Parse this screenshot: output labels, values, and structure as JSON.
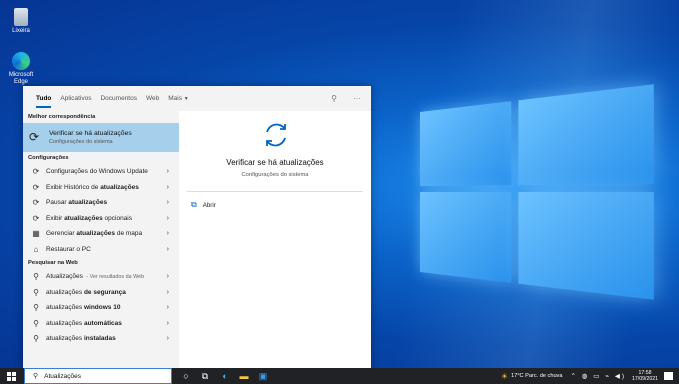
{
  "desktop": {
    "icons": [
      {
        "label": "Lixeira",
        "icon": "recycle-bin-icon"
      },
      {
        "label": "Microsoft Edge",
        "icon": "edge-icon"
      }
    ]
  },
  "search": {
    "tabs": [
      "Tudo",
      "Aplicativos",
      "Documentos",
      "Web",
      "Mais"
    ],
    "best_match_header": "Melhor correspondência",
    "best_match": {
      "title": "Verificar se há atualizações",
      "subtitle": "Configurações do sistema"
    },
    "settings_header": "Configurações",
    "settings_items": [
      {
        "pre": "Configurações do Windows Update",
        "bold": "",
        "post": "",
        "icon": "refresh-icon"
      },
      {
        "pre": "Exibir Histórico de ",
        "bold": "atualizações",
        "post": "",
        "icon": "refresh-icon"
      },
      {
        "pre": "Pausar ",
        "bold": "atualizações",
        "post": "",
        "icon": "refresh-icon"
      },
      {
        "pre": "Exibir ",
        "bold": "atualizações",
        "post": " opcionais",
        "icon": "refresh-icon"
      },
      {
        "pre": "Gerenciar ",
        "bold": "atualizações",
        "post": " de mapa",
        "icon": "map-icon"
      },
      {
        "pre": "Restaurar o PC",
        "bold": "",
        "post": "",
        "icon": "restore-icon"
      }
    ],
    "web_header": "Pesquisar na Web",
    "web_items": [
      {
        "pre": "Atualizações",
        "bold": "",
        "post": "",
        "sub": " - Ver resultados da Web"
      },
      {
        "pre": "atualizações ",
        "bold": "de segurança",
        "post": "",
        "sub": ""
      },
      {
        "pre": "atualizações ",
        "bold": "windows 10",
        "post": "",
        "sub": ""
      },
      {
        "pre": "atualizações ",
        "bold": "automáticas",
        "post": "",
        "sub": ""
      },
      {
        "pre": "atualizações ",
        "bold": "instaladas",
        "post": "",
        "sub": ""
      }
    ],
    "detail": {
      "title": "Verificar se há atualizações",
      "subtitle": "Configurações do sistema",
      "open_label": "Abrir"
    }
  },
  "taskbar": {
    "search_value": "Atualizações",
    "weather": "17°C  Parc. de chuva",
    "time": "17:58",
    "date": "17/09/2021"
  },
  "colors": {
    "accent": "#0067c0",
    "selected": "#a6cfeb",
    "taskbar": "#202226"
  }
}
